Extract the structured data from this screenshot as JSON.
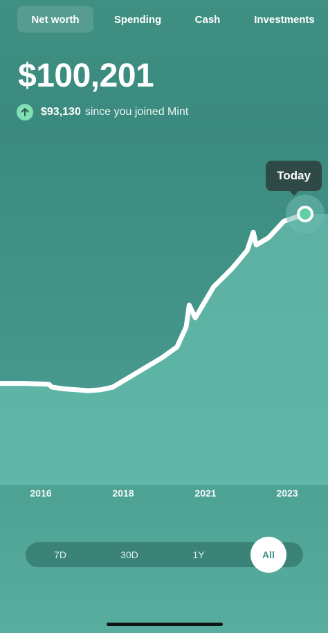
{
  "tabs": [
    {
      "label": "Net worth",
      "active": true
    },
    {
      "label": "Spending",
      "active": false
    },
    {
      "label": "Cash",
      "active": false
    },
    {
      "label": "Investments",
      "active": false
    }
  ],
  "summary": {
    "value": "$100,201",
    "change_amount": "$93,130",
    "change_text": "since you joined Mint",
    "change_icon": "arrow-up-icon"
  },
  "tooltip": {
    "label": "Today"
  },
  "chart_data": {
    "type": "area",
    "x_tick_labels": [
      "2016",
      "2018",
      "2021",
      "2023"
    ],
    "note": "Relative net-worth trend over time; values estimated as share of the final value ($100,201).",
    "points": [
      {
        "t": 0.0,
        "v": 0.07
      },
      {
        "t": 0.08,
        "v": 0.07
      },
      {
        "t": 0.16,
        "v": 0.065
      },
      {
        "t": 0.17,
        "v": 0.05
      },
      {
        "t": 0.21,
        "v": 0.04
      },
      {
        "t": 0.25,
        "v": 0.035
      },
      {
        "t": 0.29,
        "v": 0.03
      },
      {
        "t": 0.33,
        "v": 0.035
      },
      {
        "t": 0.37,
        "v": 0.05
      },
      {
        "t": 0.42,
        "v": 0.1
      },
      {
        "t": 0.47,
        "v": 0.15
      },
      {
        "t": 0.53,
        "v": 0.21
      },
      {
        "t": 0.58,
        "v": 0.27
      },
      {
        "t": 0.61,
        "v": 0.38
      },
      {
        "t": 0.62,
        "v": 0.5
      },
      {
        "t": 0.64,
        "v": 0.43
      },
      {
        "t": 0.7,
        "v": 0.6
      },
      {
        "t": 0.76,
        "v": 0.7
      },
      {
        "t": 0.81,
        "v": 0.8
      },
      {
        "t": 0.83,
        "v": 0.9
      },
      {
        "t": 0.84,
        "v": 0.83
      },
      {
        "t": 0.88,
        "v": 0.87
      },
      {
        "t": 0.93,
        "v": 0.96
      },
      {
        "t": 1.0,
        "v": 1.0
      }
    ]
  },
  "range_options": [
    {
      "label": "7D",
      "active": false
    },
    {
      "label": "30D",
      "active": false
    },
    {
      "label": "1Y",
      "active": false
    },
    {
      "label": "All",
      "active": true
    }
  ],
  "colors": {
    "background": "#3f8f82",
    "area_fill": "#6cc3b2",
    "line": "#ffffff",
    "up_badge": "#7fe0b4",
    "tooltip_bg": "#2f4a46",
    "active_dot": "#5fd0a5"
  }
}
